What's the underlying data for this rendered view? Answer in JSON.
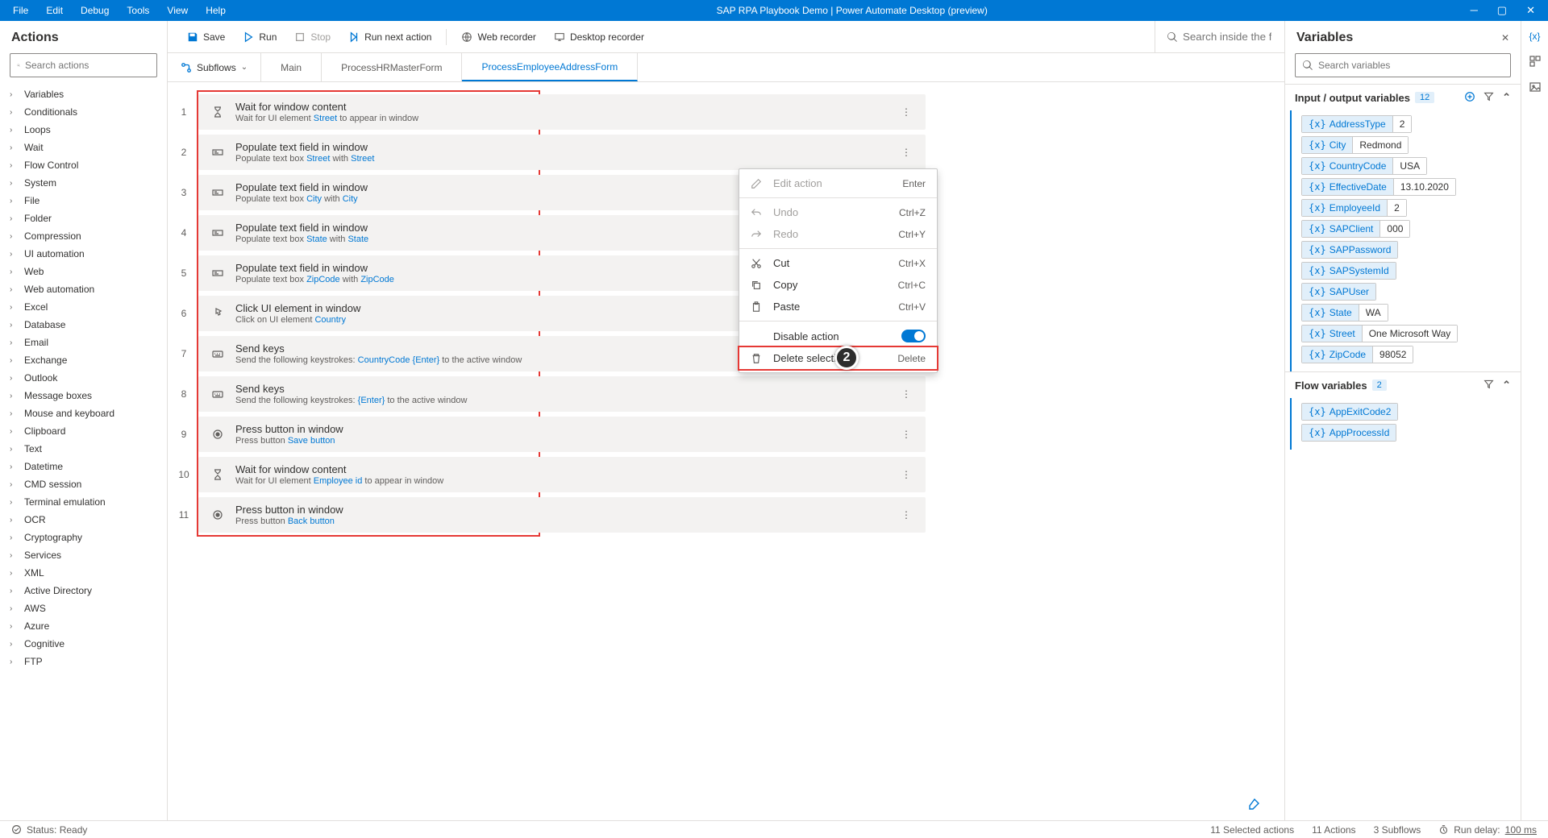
{
  "titlebar": {
    "menus": [
      "File",
      "Edit",
      "Debug",
      "Tools",
      "View",
      "Help"
    ],
    "title": "SAP RPA Playbook Demo | Power Automate Desktop (preview)"
  },
  "left": {
    "header": "Actions",
    "search_ph": "Search actions",
    "categories": [
      "Variables",
      "Conditionals",
      "Loops",
      "Wait",
      "Flow Control",
      "System",
      "File",
      "Folder",
      "Compression",
      "UI automation",
      "Web",
      "Web automation",
      "Excel",
      "Database",
      "Email",
      "Exchange",
      "Outlook",
      "Message boxes",
      "Mouse and keyboard",
      "Clipboard",
      "Text",
      "Datetime",
      "CMD session",
      "Terminal emulation",
      "OCR",
      "Cryptography",
      "Services",
      "XML",
      "Active Directory",
      "AWS",
      "Azure",
      "Cognitive",
      "FTP"
    ]
  },
  "toolbar": {
    "save": "Save",
    "run": "Run",
    "stop": "Stop",
    "run_next": "Run next action",
    "web": "Web recorder",
    "desktop": "Desktop recorder",
    "search_ph": "Search inside the flow"
  },
  "tabs": {
    "subflows": "Subflows",
    "items": [
      "Main",
      "ProcessHRMasterForm",
      "ProcessEmployeeAddressForm"
    ],
    "active": 2
  },
  "steps": [
    {
      "n": "1",
      "icon": "hourglass",
      "title": "Wait for window content",
      "desc": "Wait for UI element <lnk>Street</lnk> to appear in window"
    },
    {
      "n": "2",
      "icon": "textbox",
      "title": "Populate text field in window",
      "desc": "Populate text box <lnk>Street</lnk> with   <lnk>Street</lnk>"
    },
    {
      "n": "3",
      "icon": "textbox",
      "title": "Populate text field in window",
      "desc": "Populate text box <lnk>City</lnk> with   <lnk>City</lnk>"
    },
    {
      "n": "4",
      "icon": "textbox",
      "title": "Populate text field in window",
      "desc": "Populate text box <lnk>State</lnk> with   <lnk>State</lnk>"
    },
    {
      "n": "5",
      "icon": "textbox",
      "title": "Populate text field in window",
      "desc": "Populate text box <lnk>ZipCode</lnk> with   <lnk>ZipCode</lnk>"
    },
    {
      "n": "6",
      "icon": "click",
      "title": "Click UI element in window",
      "desc": "Click on UI element <lnk>Country</lnk>"
    },
    {
      "n": "7",
      "icon": "keys",
      "title": "Send keys",
      "desc": "Send the following keystrokes:   <lnk>CountryCode</lnk>   <lnk>{Enter}</lnk> to the active window"
    },
    {
      "n": "8",
      "icon": "keys",
      "title": "Send keys",
      "desc": "Send the following keystrokes: <lnk>{Enter}</lnk> to the active window"
    },
    {
      "n": "9",
      "icon": "button",
      "title": "Press button in window",
      "desc": "Press button <lnk>Save button</lnk>"
    },
    {
      "n": "10",
      "icon": "hourglass",
      "title": "Wait for window content",
      "desc": "Wait for UI element <lnk>Employee id</lnk> to appear in window"
    },
    {
      "n": "11",
      "icon": "button",
      "title": "Press button in window",
      "desc": "Press button <lnk>Back button</lnk>"
    }
  ],
  "context_menu": {
    "edit": "Edit action",
    "edit_sc": "Enter",
    "undo": "Undo",
    "undo_sc": "Ctrl+Z",
    "redo": "Redo",
    "redo_sc": "Ctrl+Y",
    "cut": "Cut",
    "cut_sc": "Ctrl+X",
    "copy": "Copy",
    "copy_sc": "Ctrl+C",
    "paste": "Paste",
    "paste_sc": "Ctrl+V",
    "disable": "Disable action",
    "delete": "Delete selection",
    "delete_sc": "Delete"
  },
  "right": {
    "header": "Variables",
    "search_ph": "Search variables",
    "io_title": "Input / output variables",
    "io_count": "12",
    "io_vars": [
      {
        "name": "AddressType",
        "val": "2"
      },
      {
        "name": "City",
        "val": "Redmond"
      },
      {
        "name": "CountryCode",
        "val": "USA"
      },
      {
        "name": "EffectiveDate",
        "val": "13.10.2020"
      },
      {
        "name": "EmployeeId",
        "val": "2"
      },
      {
        "name": "SAPClient",
        "val": "000"
      },
      {
        "name": "SAPPassword",
        "val": ""
      },
      {
        "name": "SAPSystemId",
        "val": ""
      },
      {
        "name": "SAPUser",
        "val": ""
      },
      {
        "name": "State",
        "val": "WA"
      },
      {
        "name": "Street",
        "val": "One Microsoft Way"
      },
      {
        "name": "ZipCode",
        "val": "98052"
      }
    ],
    "fv_title": "Flow variables",
    "fv_count": "2",
    "fv_vars": [
      {
        "name": "AppExitCode2",
        "val": ""
      },
      {
        "name": "AppProcessId",
        "val": ""
      }
    ]
  },
  "statusbar": {
    "status": "Status: Ready",
    "selected": "11 Selected actions",
    "actions": "11 Actions",
    "subflows": "3 Subflows",
    "delay_lbl": "Run delay:",
    "delay_val": "100 ms"
  }
}
